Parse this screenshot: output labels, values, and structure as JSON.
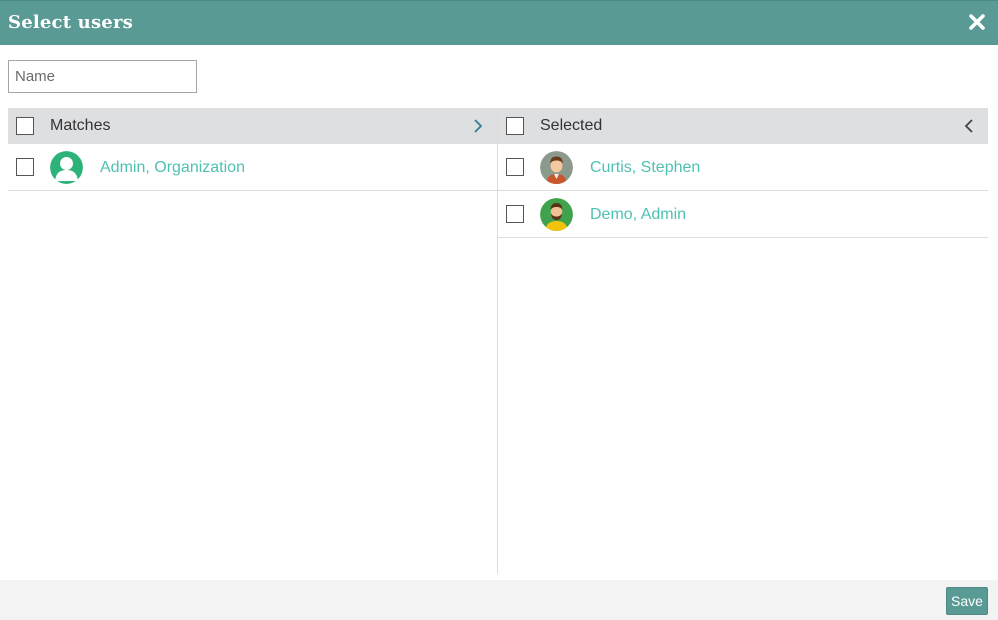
{
  "dialog": {
    "title": "Select users",
    "close_icon": "close-icon"
  },
  "search": {
    "placeholder": "Name",
    "value": ""
  },
  "matches": {
    "header_label": "Matches",
    "move_icon": "chevron-right-icon",
    "items": [
      {
        "name": "Admin, Organization",
        "avatar": "default-user-avatar",
        "checked": false
      }
    ]
  },
  "selected": {
    "header_label": "Selected",
    "move_icon": "chevron-left-icon",
    "items": [
      {
        "name": "Curtis, Stephen",
        "avatar": "man-avatar-brown",
        "checked": false
      },
      {
        "name": "Demo, Admin",
        "avatar": "man-avatar-bearded",
        "checked": false
      }
    ]
  },
  "footer": {
    "save_label": "Save"
  },
  "colors": {
    "accent": "#5a9a95",
    "link": "#4fc1b3",
    "header_bg": "#dedfe1"
  }
}
